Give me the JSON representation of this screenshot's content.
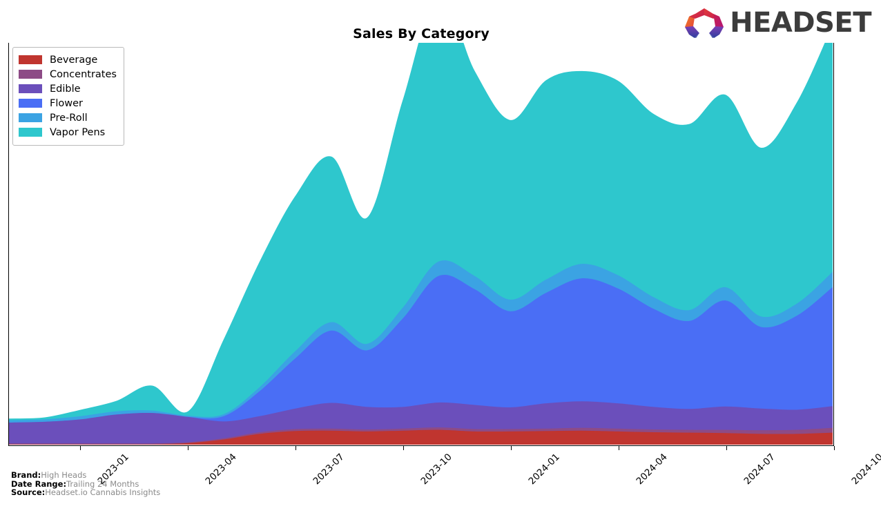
{
  "header": {
    "title": "Sales By Category",
    "logo_text": "HEADSET",
    "logo_icon": "headset-arch-logo"
  },
  "legend": {
    "position": "top-left",
    "items": [
      {
        "label": "Beverage",
        "color": "#c0352f"
      },
      {
        "label": "Concentrates",
        "color": "#8d4b86"
      },
      {
        "label": "Edible",
        "color": "#6b4fbb"
      },
      {
        "label": "Flower",
        "color": "#4a6ef5"
      },
      {
        "label": "Pre-Roll",
        "color": "#3ba3e3"
      },
      {
        "label": "Vapor Pens",
        "color": "#2ec7cd"
      }
    ]
  },
  "footer": {
    "rows": [
      {
        "key": "Brand:",
        "value": "High Heads"
      },
      {
        "key": "Date Range:",
        "value": "Trailing 24 Months"
      },
      {
        "key": "Source:",
        "value": "Headset.io Cannabis Insights"
      }
    ]
  },
  "chart_data": {
    "type": "area",
    "stacked": true,
    "smoothing": "spline",
    "title": "Sales By Category",
    "xlabel": "",
    "ylabel": "",
    "grid": false,
    "y_axis_labels_visible": false,
    "legend_position": "top-left",
    "x": [
      "2022-11",
      "2022-12",
      "2023-01",
      "2023-02",
      "2023-03",
      "2023-04",
      "2023-05",
      "2023-06",
      "2023-07",
      "2023-08",
      "2023-09",
      "2023-10",
      "2023-11",
      "2023-12",
      "2024-01",
      "2024-02",
      "2024-03",
      "2024-04",
      "2024-05",
      "2024-06",
      "2024-07",
      "2024-08",
      "2024-09",
      "2024-10"
    ],
    "tick_labels": [
      "2023-01",
      "2023-04",
      "2023-07",
      "2023-10",
      "2024-01",
      "2024-04",
      "2024-07",
      "2024-10"
    ],
    "ylim": [
      0,
      100
    ],
    "series": [
      {
        "name": "Beverage",
        "color": "#c0352f",
        "values": [
          0.0,
          0.0,
          0.0,
          0.0,
          0.0,
          0.3,
          1.2,
          2.6,
          3.3,
          3.4,
          3.2,
          3.4,
          3.6,
          3.2,
          3.2,
          3.3,
          3.4,
          3.2,
          3.0,
          2.9,
          2.8,
          2.6,
          2.6,
          2.9
        ]
      },
      {
        "name": "Concentrates",
        "color": "#8d4b86",
        "values": [
          0.2,
          0.2,
          0.2,
          0.2,
          0.2,
          0.2,
          0.3,
          0.4,
          0.5,
          0.5,
          0.5,
          0.5,
          0.6,
          0.6,
          0.6,
          0.6,
          0.7,
          0.7,
          0.7,
          0.7,
          0.8,
          0.9,
          1.0,
          1.2
        ]
      },
      {
        "name": "Edible",
        "color": "#6b4fbb",
        "values": [
          5.2,
          5.4,
          6.0,
          7.2,
          7.6,
          6.3,
          4.2,
          4.0,
          5.1,
          6.4,
          5.6,
          5.4,
          6.2,
          6.0,
          5.4,
          6.3,
          6.6,
          6.3,
          5.6,
          5.2,
          5.8,
          5.4,
          5.0,
          5.4
        ]
      },
      {
        "name": "Flower",
        "color": "#4a6ef5",
        "values": [
          0.0,
          0.0,
          0.0,
          0.0,
          0.0,
          0.0,
          1.3,
          6.2,
          12.5,
          18.0,
          14.1,
          22.0,
          31.5,
          28.8,
          23.9,
          27.5,
          30.6,
          28.6,
          24.4,
          21.9,
          26.4,
          20.3,
          23.4,
          29.6
        ]
      },
      {
        "name": "Pre-Roll",
        "color": "#3ba3e3",
        "values": [
          0.6,
          0.6,
          0.8,
          0.8,
          0.6,
          0.3,
          0.5,
          1.0,
          1.8,
          2.1,
          1.6,
          2.7,
          3.6,
          3.3,
          2.9,
          3.3,
          3.6,
          3.3,
          2.9,
          2.7,
          3.3,
          2.6,
          3.0,
          3.8
        ]
      },
      {
        "name": "Vapor Pens",
        "color": "#2ec7cd",
        "values": [
          0.4,
          0.5,
          1.6,
          2.6,
          6.2,
          1.1,
          18.6,
          31.2,
          38.6,
          41.2,
          31.4,
          51.6,
          66.5,
          51.0,
          44.7,
          49.6,
          48.0,
          48.4,
          45.6,
          46.3,
          47.9,
          42.0,
          50.0,
          61.4
        ]
      }
    ]
  }
}
